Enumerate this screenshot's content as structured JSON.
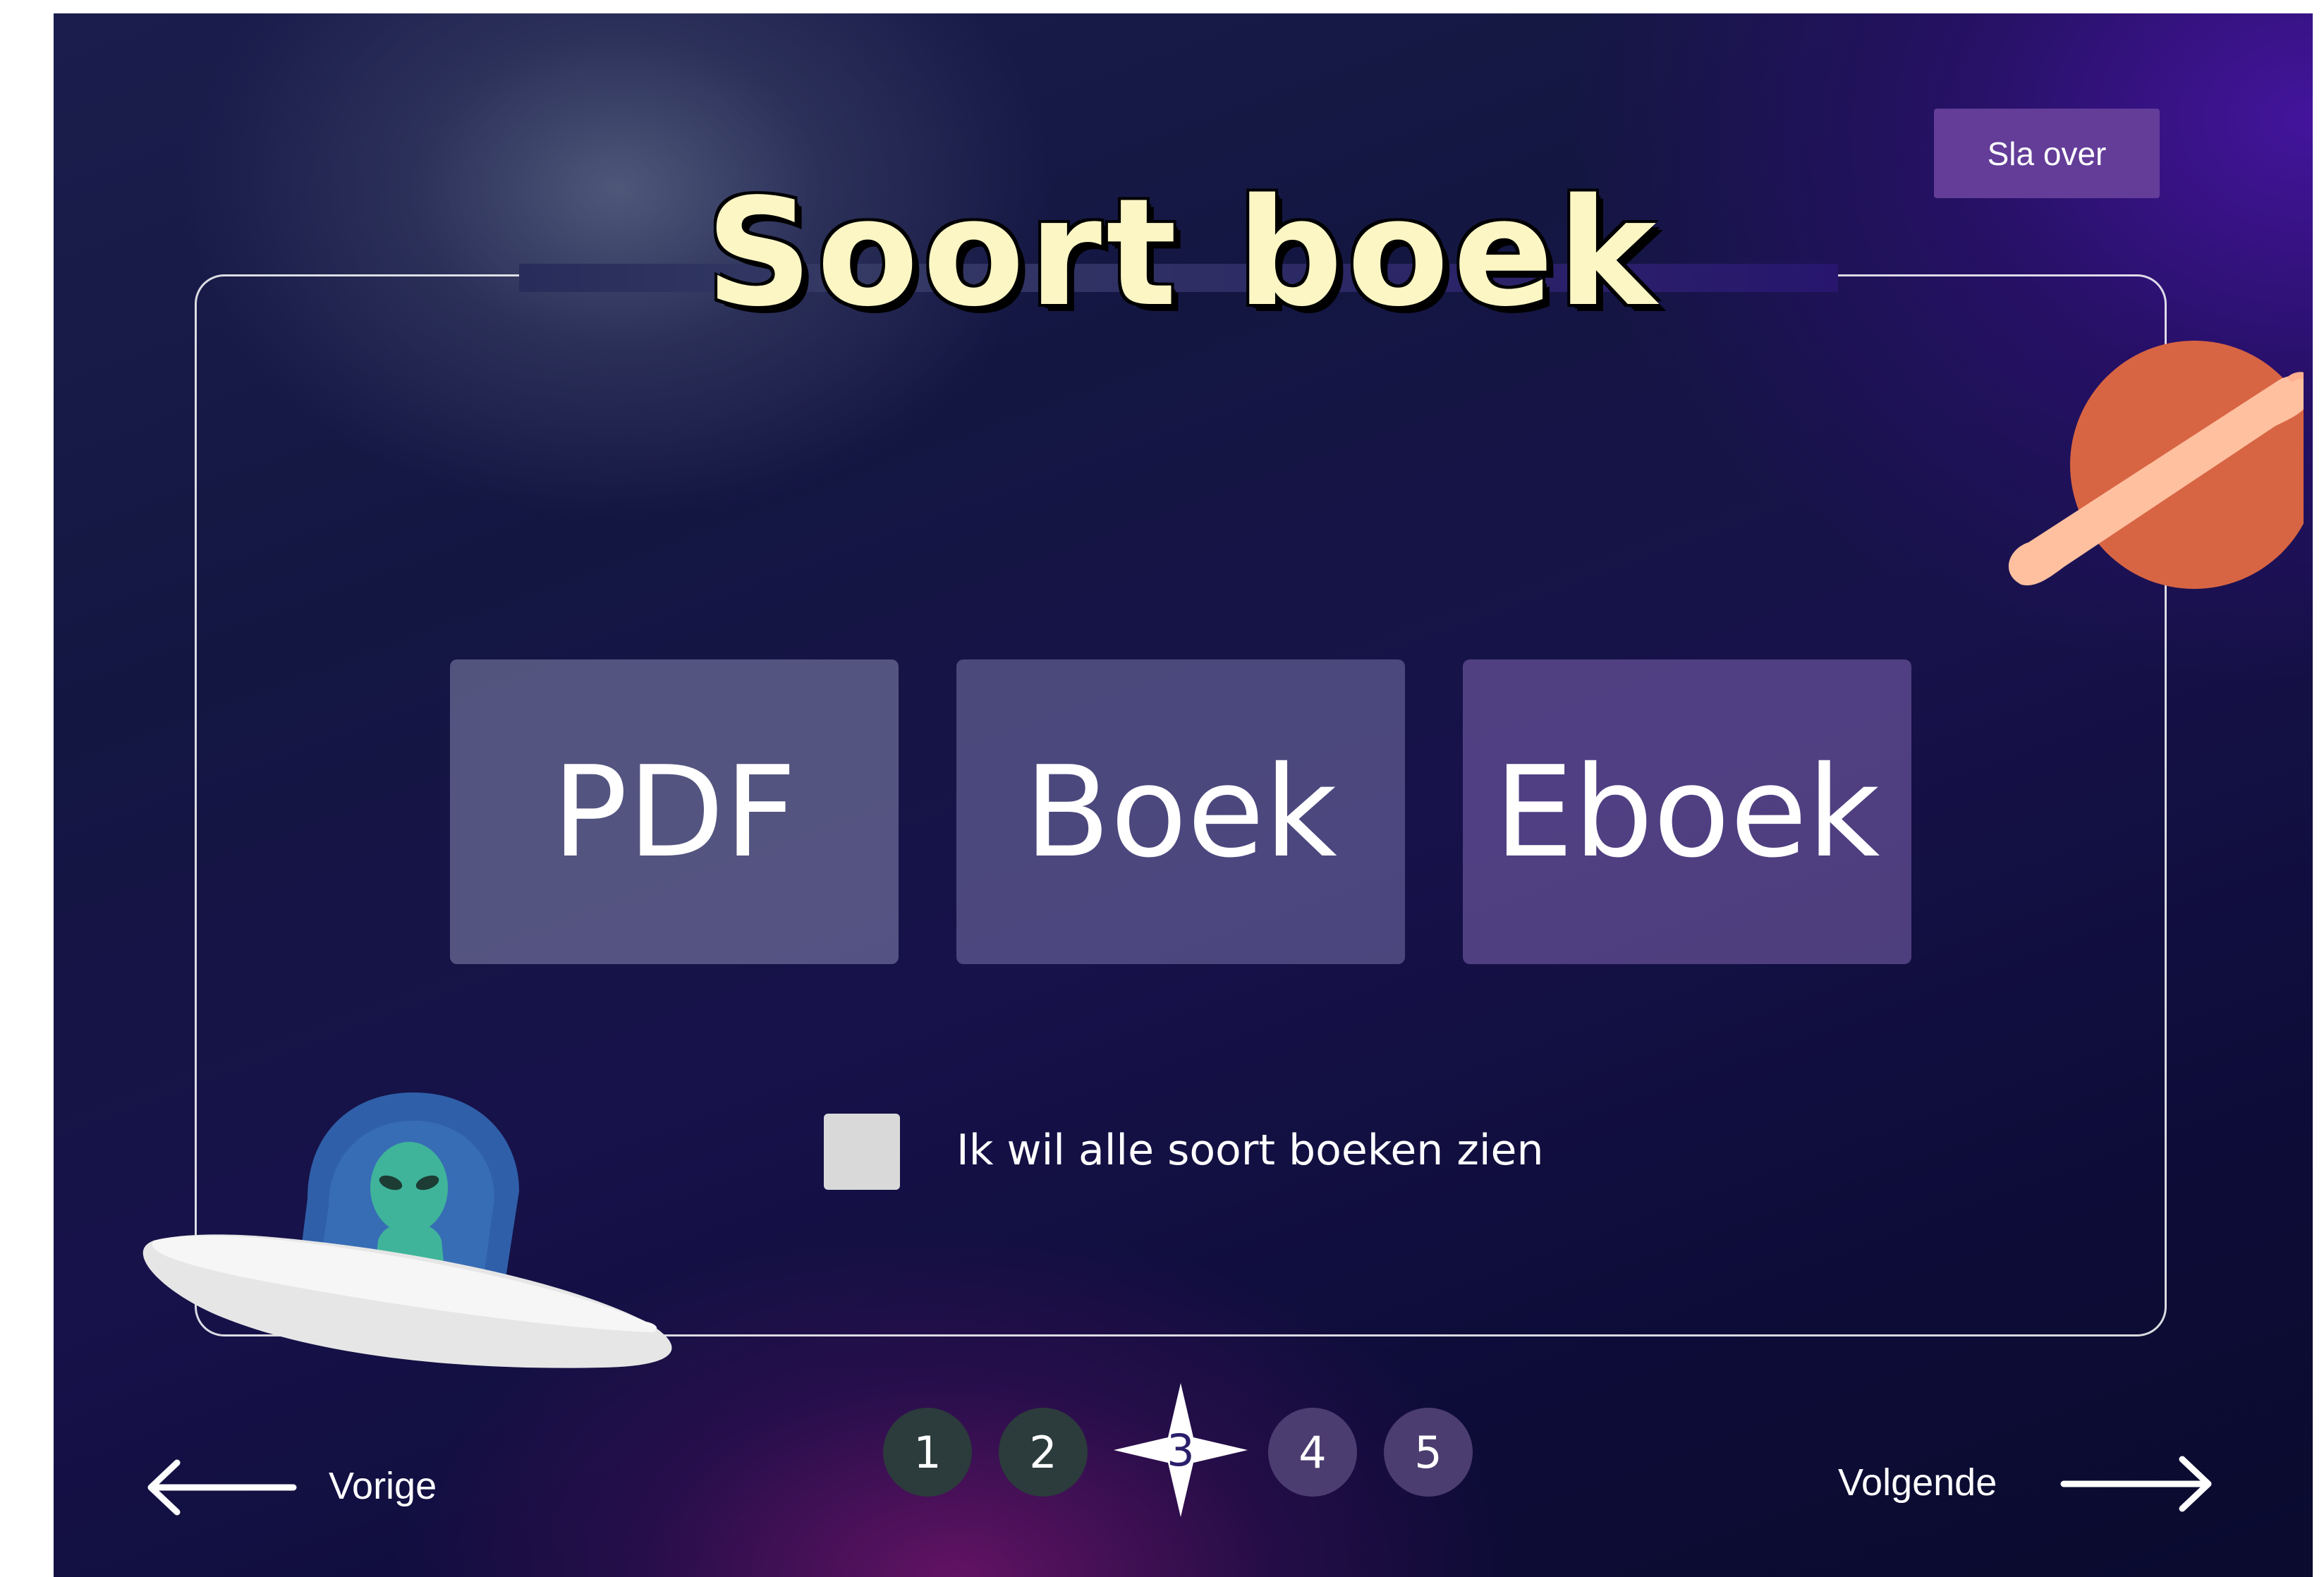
{
  "header": {
    "title": "Soort boek",
    "skip_label": "Sla over"
  },
  "options": [
    {
      "label": "PDF"
    },
    {
      "label": "Boek"
    },
    {
      "label": "Eboek"
    }
  ],
  "show_all": {
    "label": "Ik wil alle soort boeken zien",
    "checked": false
  },
  "steps": {
    "items": [
      "1",
      "2",
      "3",
      "4",
      "5"
    ],
    "current": 3
  },
  "navigation": {
    "prev_label": "Vorige",
    "next_label": "Volgende"
  },
  "colors": {
    "title": "#fbf6c4",
    "skip_button": "#633d98",
    "planet": "#d76543",
    "planet_ring": "#ffc0a0",
    "ufo_dome": "#2f5fa8",
    "alien": "#3fb49a"
  },
  "icons": {
    "prev": "arrow-left-icon",
    "next": "arrow-right-icon",
    "current_step": "star-icon"
  }
}
